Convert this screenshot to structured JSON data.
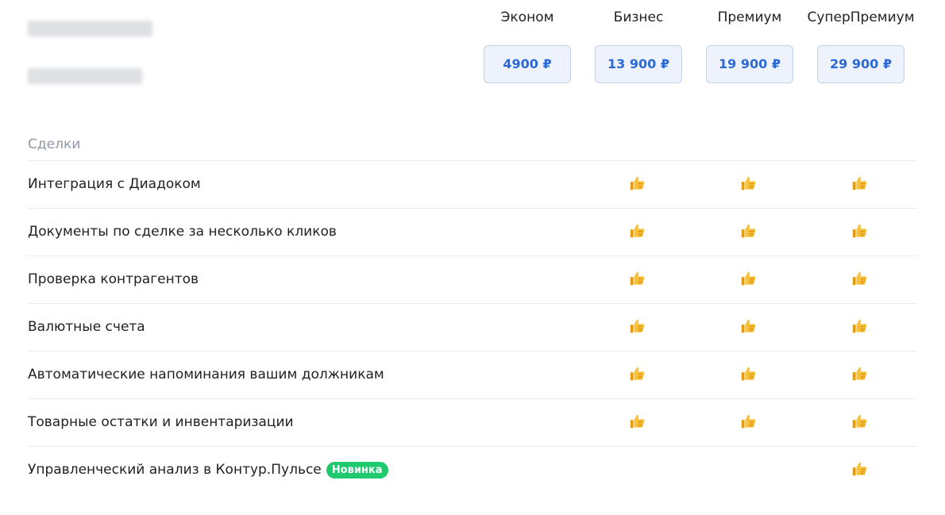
{
  "plans": [
    {
      "name": "Эконом",
      "price": "4900 ₽"
    },
    {
      "name": "Бизнес",
      "price": "13 900 ₽"
    },
    {
      "name": "Премиум",
      "price": "19 900 ₽"
    },
    {
      "name": "СуперПремиум",
      "price": "29 900 ₽"
    }
  ],
  "section": {
    "title": "Сделки"
  },
  "rows": [
    {
      "label": "Интеграция с Диадоком",
      "badge": "",
      "included": [
        false,
        true,
        true,
        true
      ]
    },
    {
      "label": "Документы по сделке за несколько кликов",
      "badge": "",
      "included": [
        false,
        true,
        true,
        true
      ]
    },
    {
      "label": "Проверка контрагентов",
      "badge": "",
      "included": [
        false,
        true,
        true,
        true
      ]
    },
    {
      "label": "Валютные счета",
      "badge": "",
      "included": [
        false,
        true,
        true,
        true
      ]
    },
    {
      "label": "Автоматические напоминания вашим должникам",
      "badge": "",
      "included": [
        false,
        true,
        true,
        true
      ]
    },
    {
      "label": "Товарные остатки и инвентаризации",
      "badge": "",
      "included": [
        false,
        true,
        true,
        true
      ]
    },
    {
      "label": "Управленческий анализ в Контур.Пульсе",
      "badge": "Новинка",
      "included": [
        false,
        false,
        false,
        true
      ]
    }
  ],
  "icons": {
    "included": "thumbs-up-icon"
  },
  "colors": {
    "accent": "#2b6ad6",
    "price_bg": "#eef2fd",
    "badge": "#1fc96e",
    "section": "#8e98a8",
    "thumb": "#f5b52a"
  }
}
